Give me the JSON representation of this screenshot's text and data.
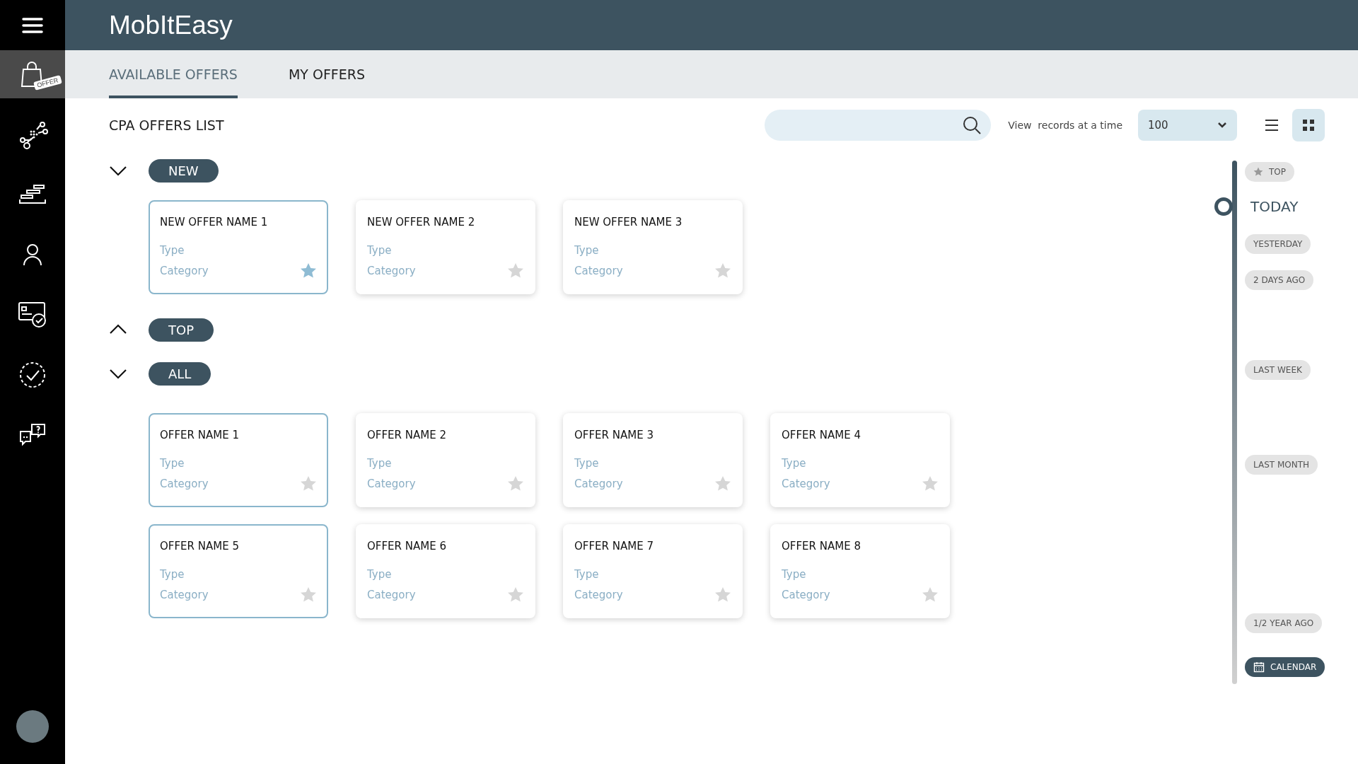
{
  "app": {
    "title": "MobItEasy"
  },
  "sidebar": {
    "items": [
      {
        "kind": "offers",
        "badge": "OFFER",
        "selected": true
      },
      {
        "kind": "network",
        "selected": false
      },
      {
        "kind": "stack",
        "selected": false
      },
      {
        "kind": "user",
        "selected": false
      },
      {
        "kind": "card",
        "selected": false
      },
      {
        "kind": "check",
        "selected": false
      },
      {
        "kind": "chat",
        "selected": false
      }
    ]
  },
  "tabs": [
    {
      "label": "AVAILABLE OFFERS",
      "selected": true
    },
    {
      "label": "MY OFFERS",
      "selected": false
    }
  ],
  "toolbar": {
    "title": "CPA OFFERS LIST",
    "view_label": "View  records at a time",
    "records": "100",
    "view_modes": [
      {
        "kind": "list",
        "selected": false
      },
      {
        "kind": "grid",
        "selected": true
      }
    ]
  },
  "sections": [
    {
      "label": "NEW",
      "expanded": true,
      "offers": [
        {
          "name": "NEW OFFER NAME 1",
          "type": "Type",
          "category": "Category",
          "selected": true,
          "starred": true
        },
        {
          "name": "NEW OFFER NAME 2",
          "type": "Type",
          "category": "Category",
          "selected": false,
          "starred": false
        },
        {
          "name": "NEW OFFER NAME 3",
          "type": "Type",
          "category": "Category",
          "selected": false,
          "starred": false
        }
      ]
    },
    {
      "label": "TOP",
      "expanded": false
    },
    {
      "label": "ALL",
      "expanded": true,
      "offers": [
        {
          "name": "OFFER NAME 1",
          "type": "Type",
          "category": "Category",
          "selected": true,
          "starred": false
        },
        {
          "name": "OFFER NAME 2",
          "type": "Type",
          "category": "Category",
          "selected": false,
          "starred": false
        },
        {
          "name": "OFFER NAME 3",
          "type": "Type",
          "category": "Category",
          "selected": false,
          "starred": false
        },
        {
          "name": "OFFER NAME 4",
          "type": "Type",
          "category": "Category",
          "selected": false,
          "starred": false
        },
        {
          "name": "OFFER NAME 5",
          "type": "Type",
          "category": "Category",
          "selected": true,
          "starred": false
        },
        {
          "name": "OFFER NAME 6",
          "type": "Type",
          "category": "Category",
          "selected": false,
          "starred": false
        },
        {
          "name": "OFFER NAME 7",
          "type": "Type",
          "category": "Category",
          "selected": false,
          "starred": false
        },
        {
          "name": "OFFER NAME 8",
          "type": "Type",
          "category": "Category",
          "selected": false,
          "starred": false
        }
      ]
    }
  ],
  "timeline": [
    {
      "kind": "top",
      "label": "TOP",
      "selected": false
    },
    {
      "kind": "period",
      "label": "TODAY",
      "selected": true
    },
    {
      "kind": "period",
      "label": "YESTERDAY",
      "selected": false
    },
    {
      "kind": "period",
      "label": "2 DAYS AGO",
      "selected": false
    },
    {
      "kind": "period",
      "label": "LAST WEEK",
      "selected": false
    },
    {
      "kind": "period",
      "label": "LAST MONTH",
      "selected": false
    },
    {
      "kind": "period",
      "label": "1/2 YEAR AGO",
      "selected": false
    },
    {
      "kind": "calendar",
      "label": "CALENDAR",
      "selected": false
    }
  ]
}
